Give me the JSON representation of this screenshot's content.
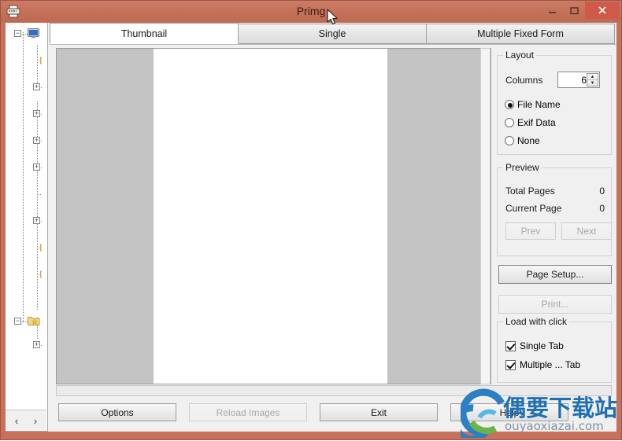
{
  "window": {
    "title": "Primg",
    "icon": "printer-icon",
    "titlebar_color": "#c47159",
    "close_button_color": "#cf5a4a",
    "controls": {
      "minimize": "minimize-icon",
      "maximize": "maximize-icon",
      "close": "close-icon"
    }
  },
  "tabs": [
    {
      "label": "Thumbnail",
      "active": true
    },
    {
      "label": "Single",
      "active": false
    },
    {
      "label": "Multiple Fixed Form",
      "active": false
    }
  ],
  "tree": {
    "hscroll_left": "‹",
    "hscroll_right": "›",
    "nodes": [
      {
        "expander": "−",
        "icon": "computer-icon",
        "indent": 0
      },
      {
        "expander": "",
        "icon": "folder-icon",
        "indent": 1
      },
      {
        "expander": "+",
        "icon": "drive-icon",
        "indent": 1
      },
      {
        "expander": "+",
        "icon": "folder-icon",
        "indent": 1
      },
      {
        "expander": "+",
        "icon": "network-icon",
        "indent": 1
      },
      {
        "expander": "+",
        "icon": "drive-icon",
        "indent": 1
      },
      {
        "expander": "",
        "icon": "device-icon",
        "indent": 1
      },
      {
        "expander": "+",
        "icon": "folder-icon",
        "indent": 1
      },
      {
        "expander": "",
        "icon": "folder-icon",
        "indent": 1
      },
      {
        "expander": "+",
        "icon": "folder-icon",
        "indent": 1
      },
      {
        "expander": "−",
        "icon": "folder-icon",
        "indent": 1
      },
      {
        "expander": "",
        "icon": "folder-icon",
        "indent": 1
      },
      {
        "expander": "",
        "icon": "folder-icon",
        "indent": 1
      },
      {
        "expander": "−",
        "icon": "favorites-folder-icon",
        "indent": 0
      },
      {
        "expander": "+",
        "icon": "folder-icon",
        "indent": 1
      }
    ]
  },
  "preview_pane": {
    "page_background": "#ffffff",
    "surround_background": "#c3c3c3"
  },
  "layout_group": {
    "title": "Layout",
    "columns_label": "Columns",
    "columns_value": "6",
    "spin_up": "▲",
    "spin_down": "▼",
    "radios": [
      {
        "label": "File Name",
        "selected": true
      },
      {
        "label": "Exif Data",
        "selected": false
      },
      {
        "label": "None",
        "selected": false
      }
    ]
  },
  "preview_group": {
    "title": "Preview",
    "total_pages_label": "Total Pages",
    "total_pages_value": "0",
    "current_page_label": "Current Page",
    "current_page_value": "0",
    "prev_label": "Prev",
    "prev_enabled": false,
    "next_label": "Next",
    "next_enabled": false
  },
  "actions": {
    "page_setup_label": "Page Setup...",
    "page_setup_enabled": true,
    "print_label": "Print...",
    "print_enabled": false
  },
  "load_group": {
    "title": "Load with click",
    "checks": [
      {
        "label": "Single Tab",
        "checked": true
      },
      {
        "label": "Multiple ... Tab",
        "checked": true
      }
    ]
  },
  "bottom_bar": {
    "options_label": "Options",
    "options_enabled": true,
    "reload_label": "Reload Images",
    "reload_enabled": false,
    "exit_label": "Exit",
    "exit_enabled": true,
    "help_label": "Help",
    "help_enabled": true
  },
  "watermark": {
    "text": "偶要下载站",
    "subtext": "ouyaoxiazai.com",
    "color": "#1f6fb5"
  }
}
